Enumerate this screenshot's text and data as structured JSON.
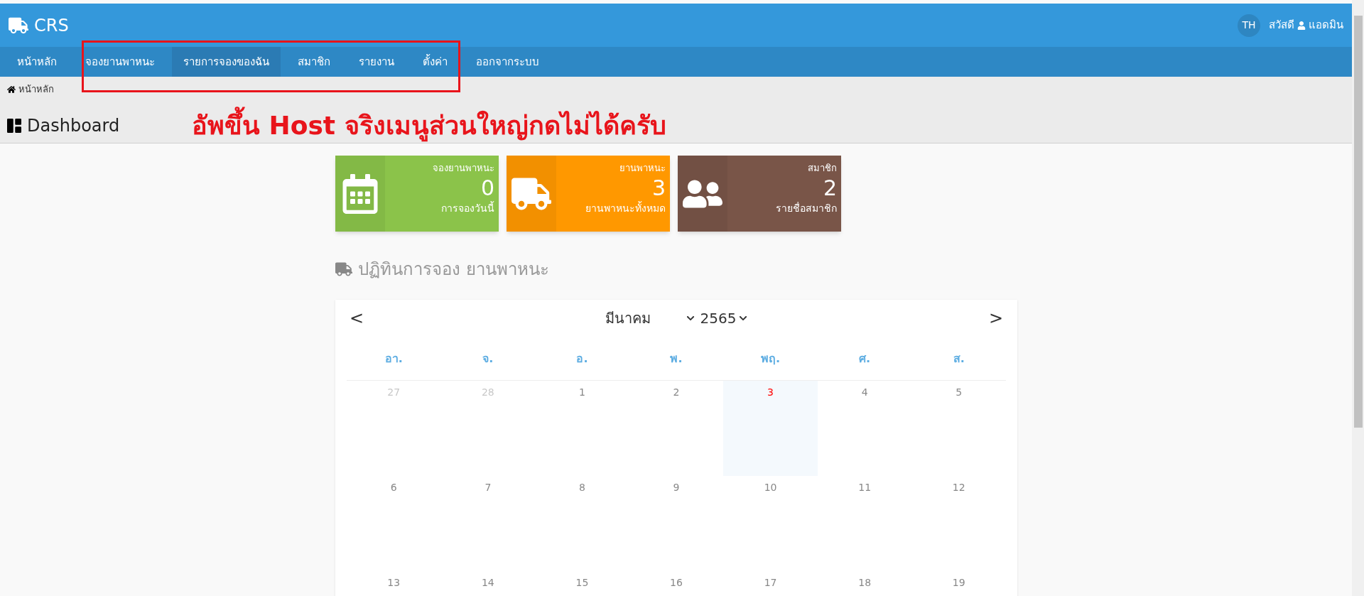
{
  "brand": {
    "title": "CRS"
  },
  "user": {
    "avatar": "TH",
    "greeting": "สวัสดี",
    "name": "แอดมิน"
  },
  "nav": [
    {
      "label": "หน้าหลัก",
      "selected": false
    },
    {
      "label": "จองยานพาหนะ",
      "selected": false
    },
    {
      "label": "รายการจองของฉัน",
      "selected": true
    },
    {
      "label": "สมาชิก",
      "selected": false
    },
    {
      "label": "รายงาน",
      "selected": false
    },
    {
      "label": "ตั้งค่า",
      "selected": false
    },
    {
      "label": "ออกจากระบบ",
      "selected": false
    }
  ],
  "breadcrumb": "หน้าหลัก",
  "page_title": "Dashboard",
  "annotation": {
    "text": "อัพขึ้น Host จริงเมนูส่วนใหญ่กดไม่ได้ครับ"
  },
  "stats": [
    {
      "kind": "calendar",
      "color": "#8bc34a",
      "title": "จองยานพาหนะ",
      "value": "0",
      "caption": "การจองวันนี้"
    },
    {
      "kind": "truck",
      "color": "#ff9800",
      "title": "ยานพาหนะ",
      "value": "3",
      "caption": "ยานพาหนะทั้งหมด"
    },
    {
      "kind": "users",
      "color": "#795548",
      "title": "สมาชิก",
      "value": "2",
      "caption": "รายชื่อสมาชิก"
    }
  ],
  "calendar": {
    "title": "ปฏิทินการจอง ยานพาหนะ",
    "prev": "<",
    "next": ">",
    "month": "มีนาคม",
    "year": "2565",
    "weekdays": [
      "อา.",
      "จ.",
      "อ.",
      "พ.",
      "พฤ.",
      "ศ.",
      "ส."
    ],
    "weeks": [
      [
        {
          "day": "27",
          "outside_month": true,
          "today": false
        },
        {
          "day": "28",
          "outside_month": true,
          "today": false
        },
        {
          "day": "1",
          "outside_month": false,
          "today": false
        },
        {
          "day": "2",
          "outside_month": false,
          "today": false
        },
        {
          "day": "3",
          "outside_month": false,
          "today": true
        },
        {
          "day": "4",
          "outside_month": false,
          "today": false
        },
        {
          "day": "5",
          "outside_month": false,
          "today": false
        }
      ],
      [
        {
          "day": "6",
          "outside_month": false,
          "today": false
        },
        {
          "day": "7",
          "outside_month": false,
          "today": false
        },
        {
          "day": "8",
          "outside_month": false,
          "today": false
        },
        {
          "day": "9",
          "outside_month": false,
          "today": false
        },
        {
          "day": "10",
          "outside_month": false,
          "today": false
        },
        {
          "day": "11",
          "outside_month": false,
          "today": false
        },
        {
          "day": "12",
          "outside_month": false,
          "today": false
        }
      ],
      [
        {
          "day": "13",
          "outside_month": false,
          "today": false
        },
        {
          "day": "14",
          "outside_month": false,
          "today": false
        },
        {
          "day": "15",
          "outside_month": false,
          "today": false
        },
        {
          "day": "16",
          "outside_month": false,
          "today": false
        },
        {
          "day": "17",
          "outside_month": false,
          "today": false
        },
        {
          "day": "18",
          "outside_month": false,
          "today": false
        },
        {
          "day": "19",
          "outside_month": false,
          "today": false
        }
      ]
    ]
  }
}
